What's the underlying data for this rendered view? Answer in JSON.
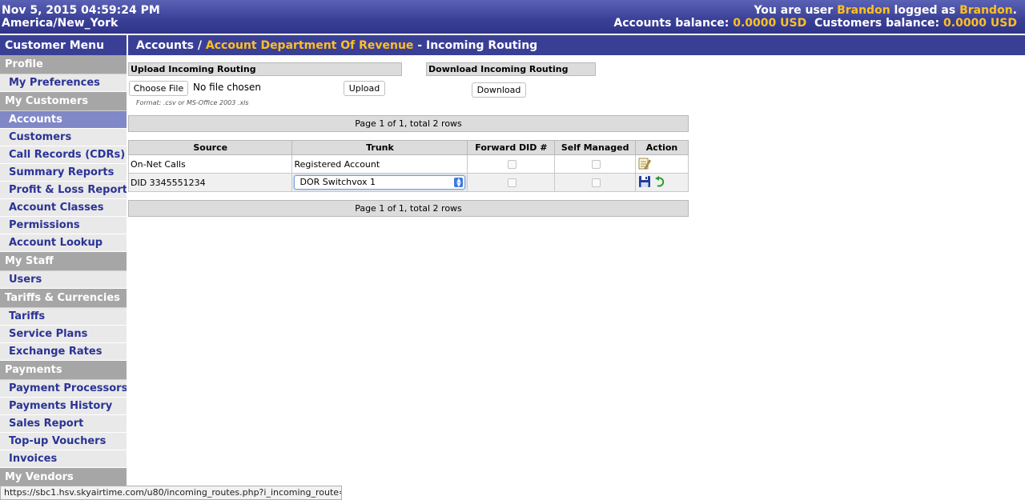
{
  "topbar": {
    "datetime": "Nov 5, 2015 04:59:24 PM",
    "timezone": "America/New_York",
    "user_prefix": "You are user ",
    "user": "Brandon",
    "logged_as": " logged as ",
    "logged_user": "Brandon",
    "period": ".",
    "accounts_balance_label": "Accounts balance: ",
    "accounts_balance": "0.0000 USD",
    "customers_balance_label": "Customers balance: ",
    "customers_balance": "0.0000 USD"
  },
  "sidebar": {
    "title": "Customer Menu",
    "sections": {
      "profile": "Profile",
      "my_customers": "My Customers",
      "my_staff": "My Staff",
      "tariffs": "Tariffs & Currencies",
      "payments": "Payments",
      "my_vendors": "My Vendors"
    },
    "items": {
      "my_preferences": "My Preferences",
      "accounts": "Accounts",
      "customers": "Customers",
      "call_records": "Call Records (CDRs)",
      "summary_reports": "Summary Reports",
      "profit_loss": "Profit & Loss Report",
      "account_classes": "Account Classes",
      "permissions": "Permissions",
      "account_lookup": "Account Lookup",
      "users": "Users",
      "tariffs": "Tariffs",
      "service_plans": "Service Plans",
      "exchange_rates": "Exchange Rates",
      "payment_processors": "Payment Processors",
      "payments_history": "Payments History",
      "sales_report": "Sales Report",
      "topup_vouchers": "Top-up Vouchers",
      "invoices": "Invoices"
    }
  },
  "header": {
    "crumb1": "Accounts",
    "sep": " / ",
    "crumb2": "Account Department Of Revenue",
    "page": " - Incoming Routing"
  },
  "upload": {
    "title": "Upload Incoming Routing",
    "choose_file": "Choose File",
    "no_file": "No file chosen",
    "upload_button": "Upload",
    "format_hint": "Format: .csv or MS-Office 2003 .xls"
  },
  "download": {
    "title": "Download Incoming Routing",
    "download_button": "Download"
  },
  "pager": {
    "text": "Page 1 of 1, total 2 rows"
  },
  "table": {
    "headers": {
      "source": "Source",
      "trunk": "Trunk",
      "forward_did": "Forward DID #",
      "self_managed": "Self Managed",
      "action": "Action"
    },
    "rows": [
      {
        "source": "On-Net Calls",
        "trunk": "Registered Account"
      },
      {
        "source": "DID 3345551234",
        "trunk": "DOR Switchvox 1"
      }
    ]
  },
  "statusbar": {
    "url": "https://sbc1.hsv.skyairtime.com/u80/incoming_routes.php?i_incoming_route=..."
  },
  "colors": {
    "accent": "#3a3f96",
    "highlight": "#ffc020",
    "link": "#2b3395",
    "active_item": "#8188c8"
  }
}
